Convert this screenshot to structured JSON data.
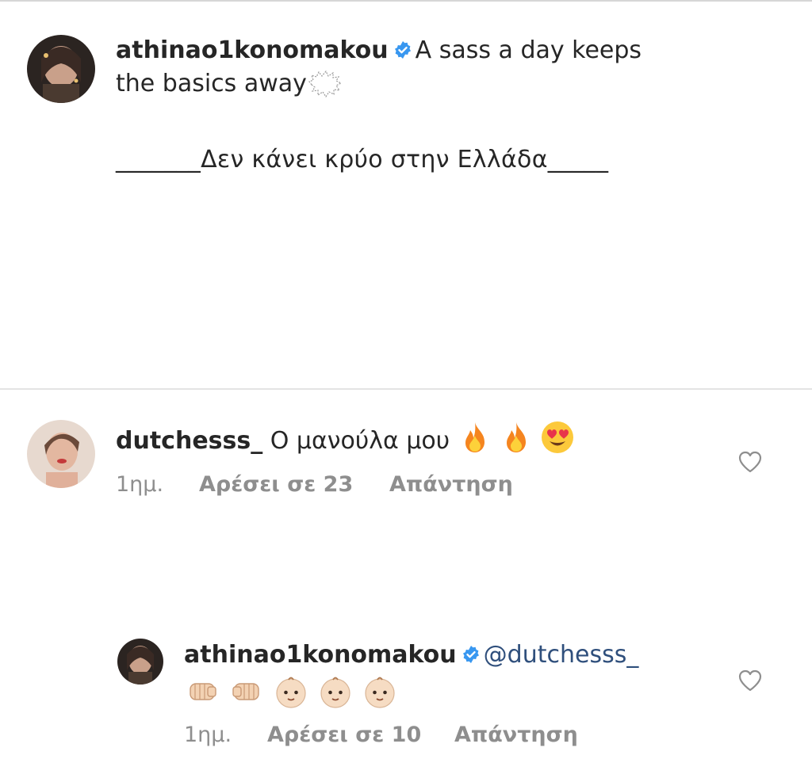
{
  "post": {
    "username": "athinao1konomakou",
    "caption_line1": "A sass a day keeps",
    "caption_line2": "the basics away",
    "subtitle": "_______Δεν κάνει κρύο στην Ελλάδα_____"
  },
  "comments": [
    {
      "username": "dutchesss_",
      "text": "Ο μανούλα μου",
      "emojis": [
        "fire-icon",
        "fire-icon",
        "heart-eyes-face-icon"
      ],
      "time": "1ημ.",
      "likes": "Αρέσει σε 23",
      "reply": "Απάντηση"
    },
    {
      "username": "athinao1konomakou",
      "mention": "@dutchesss_",
      "emojis": [
        "left-facing-fist-icon",
        "right-facing-fist-icon",
        "baby-icon",
        "baby-icon",
        "baby-icon"
      ],
      "time": "1ημ.",
      "likes": "Αρέσει σε 10",
      "reply": "Απάντηση"
    }
  ],
  "colors": {
    "verified": "#3897f0",
    "meta_gray": "#8e8e8e",
    "mention": "#2f4f7c"
  }
}
